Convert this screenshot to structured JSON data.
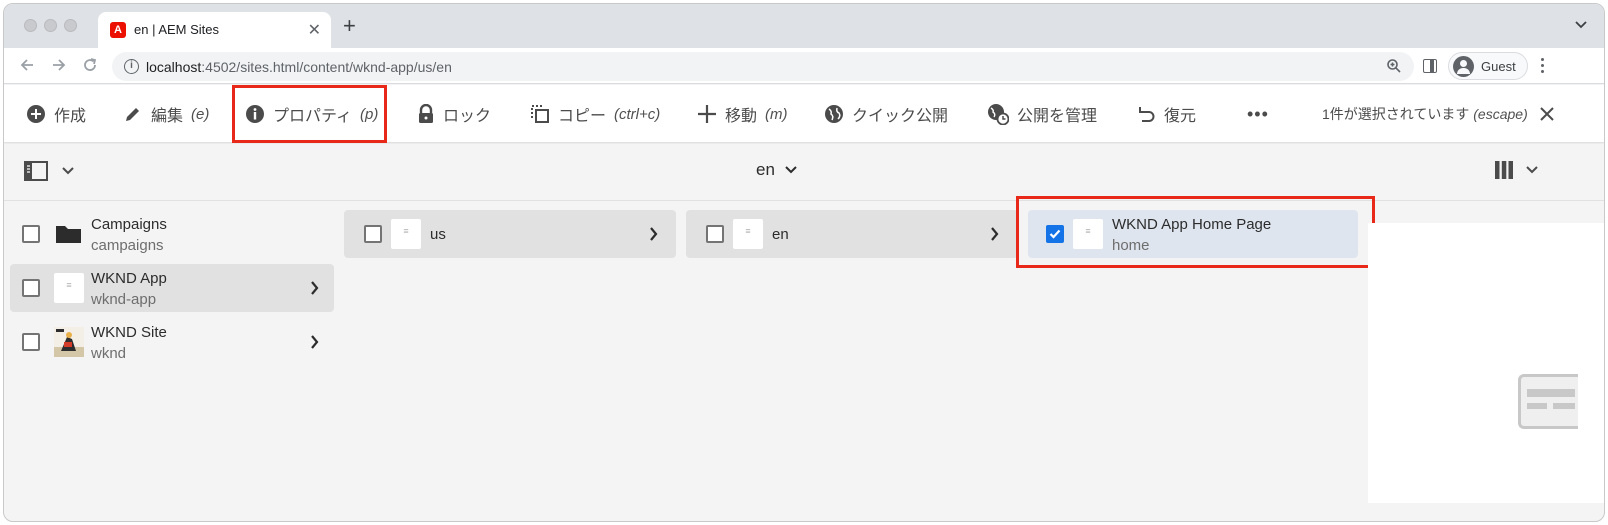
{
  "browser": {
    "tab_title": "en | AEM Sites",
    "url_host": "localhost",
    "url_path": ":4502/sites.html/content/wknd-app/us/en",
    "profile_name": "Guest"
  },
  "actionbar": {
    "create": "作成",
    "edit": "編集",
    "edit_key": "(e)",
    "properties": "プロパティ",
    "properties_key": "(p)",
    "lock": "ロック",
    "copy": "コピー",
    "copy_key": "(ctrl+c)",
    "move": "移動",
    "move_key": "(m)",
    "quick_publish": "クイック公開",
    "manage_publication": "公開を管理",
    "restore": "復元",
    "more": "•••",
    "selection_text": "1件が選択されています",
    "selection_key": "(escape)"
  },
  "view": {
    "title": "en"
  },
  "columns": {
    "col1": [
      {
        "title": "Campaigns",
        "name": "campaigns",
        "icon": "folder-icon",
        "selected_row": false
      },
      {
        "title": "WKND App",
        "name": "wknd-app",
        "icon": "page-thumbnail",
        "selected_row": true
      },
      {
        "title": "WKND Site",
        "name": "wknd",
        "icon": "site-thumbnail",
        "selected_row": false
      }
    ],
    "col2": [
      {
        "title": "us"
      }
    ],
    "col3": [
      {
        "title": "en"
      }
    ],
    "col4": [
      {
        "title": "WKND App Home Page",
        "name": "home",
        "checked": true
      }
    ]
  },
  "colors": {
    "highlight": "#e8291a",
    "checkbox_blue": "#1473e6",
    "row_selected": "#e1e1e1",
    "row_checked": "#dfe5ef"
  }
}
